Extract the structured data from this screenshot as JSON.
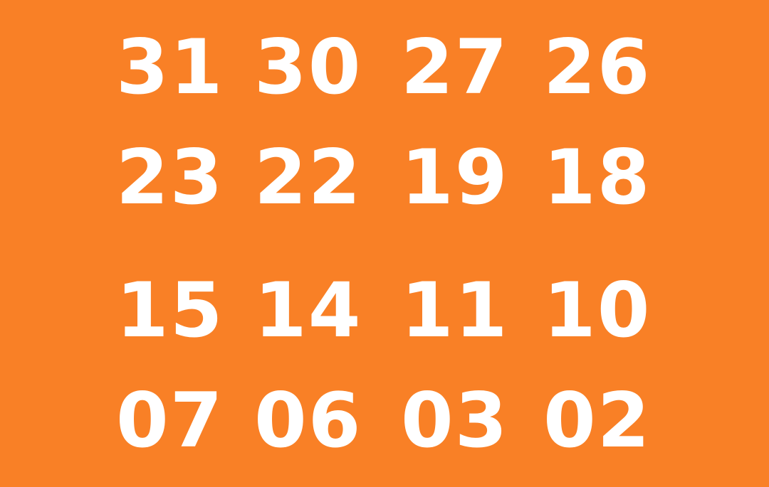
{
  "background_color": "#F98026",
  "text_color": "#FFFFFF",
  "rows": [
    [
      "31",
      "30",
      "27",
      "26"
    ],
    [
      "23",
      "22",
      "19",
      "18"
    ],
    [
      "15",
      "14",
      "11",
      "10"
    ],
    [
      "07",
      "06",
      "03",
      "02"
    ]
  ]
}
